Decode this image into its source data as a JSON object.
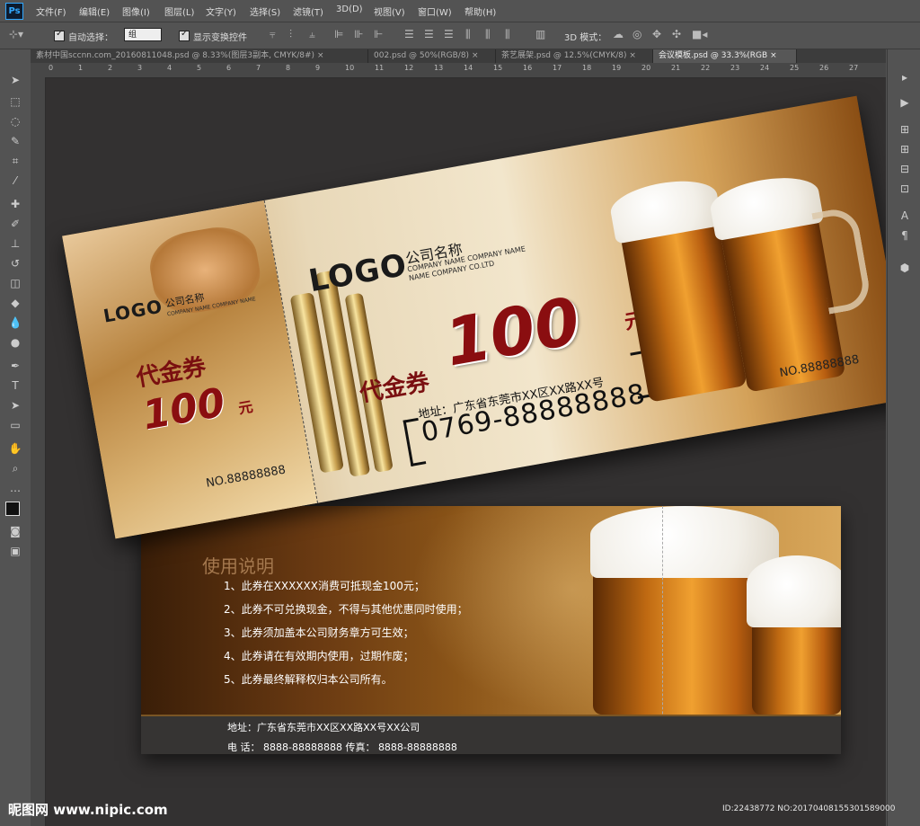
{
  "app": {
    "logo": "Ps"
  },
  "menu": [
    "文件(F)",
    "编辑(E)",
    "图像(I)",
    "图层(L)",
    "文字(Y)",
    "选择(S)",
    "滤镜(T)",
    "3D(D)",
    "视图(V)",
    "窗口(W)",
    "帮助(H)"
  ],
  "options": {
    "auto_select_label": "自动选择：",
    "auto_select_value": "组",
    "show_transform_label": "显示变换控件",
    "mode_label": "3D 模式："
  },
  "tabs": [
    {
      "label": "素材中国sccnn.com_20160811048.psd @ 8.33%(图层3副本, CMYK/8#)",
      "close": "×"
    },
    {
      "label": "002.psd @ 50%(RGB/8)",
      "close": "×"
    },
    {
      "label": "茶艺展架.psd @ 12.5%(CMYK/8)",
      "close": "×"
    },
    {
      "label": "会议模板.psd @ 33.3%(RGB",
      "close": "×"
    }
  ],
  "ruler_numbers": [
    "0",
    "1",
    "2",
    "3",
    "4",
    "5",
    "6",
    "7",
    "8",
    "9",
    "10",
    "11",
    "12",
    "13",
    "14",
    "15",
    "16",
    "17",
    "18",
    "19",
    "20",
    "21",
    "22",
    "23",
    "24",
    "25",
    "26",
    "27"
  ],
  "voucher_front": {
    "stub_logo": "LOGO",
    "stub_company": "公司名称",
    "stub_company_en": "COMPANY NAME COMPANY NAME",
    "stub_label": "代金券",
    "stub_amount": "100",
    "stub_unit": "元",
    "stub_serial": "NO.88888888",
    "logo": "LOGO",
    "company": "公司名称",
    "company_en_1": "COMPANY NAME COMPANY NAME",
    "company_en_2": "NAME COMPANY CO.LTD",
    "label": "代金券",
    "amount": "100",
    "unit": "元",
    "address": "地址：广东省东莞市XX区XX路XX号",
    "phone": "0769-88888888",
    "serial": "NO.88888888"
  },
  "voucher_back": {
    "title": "使用说明",
    "rules": [
      "1、此券在XXXXXX消费可抵现金100元；",
      "2、此券不可兑换现金，不得与其他优惠同时使用；",
      "3、此券须加盖本公司财务章方可生效；",
      "4、此券请在有效期内使用，过期作废；",
      "5、此券最终解释权归本公司所有。"
    ],
    "address": "地址：广东省东莞市XX区XX路XX号XX公司",
    "tel": "电 话：  8888-88888888   传真：  8888-88888888"
  },
  "watermark": {
    "site": "昵图网 www.nipic.com",
    "id": "ID:22438772 NO:20170408155301589000"
  }
}
